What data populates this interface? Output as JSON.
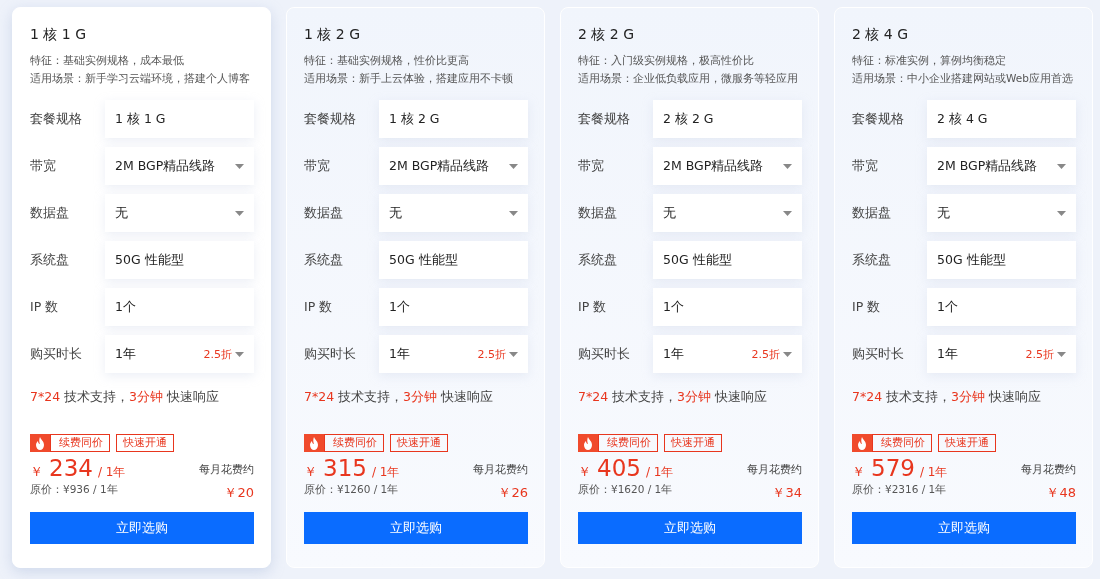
{
  "plans": [
    {
      "title": "1 核 1 G",
      "selected": true,
      "feature": "特征：基础实例规格，成本最低",
      "scene": "适用场景：新手学习云端环境，搭建个人博客",
      "rows": [
        {
          "label": "套餐规格",
          "kind": "text",
          "value": "1 核 1 G"
        },
        {
          "label": "带宽",
          "kind": "select",
          "value": "2M BGP精品线路"
        },
        {
          "label": "数据盘",
          "kind": "select",
          "value": "无"
        },
        {
          "label": "系统盘",
          "kind": "text",
          "value": "50G 性能型"
        },
        {
          "label": "IP 数",
          "kind": "text",
          "value": "1个"
        },
        {
          "label": "购买时长",
          "kind": "select",
          "value": "1年",
          "discount": "2.5折"
        }
      ],
      "support": [
        {
          "text": "7*24",
          "highlight": true
        },
        {
          "text": " 技术支持，",
          "highlight": false
        },
        {
          "text": "3分钟",
          "highlight": true
        },
        {
          "text": " 快速响应",
          "highlight": false
        }
      ],
      "tags": [
        "续费同价",
        "快速开通"
      ],
      "currency": "￥",
      "price": "234",
      "period": "/ 1年",
      "original": "原价：¥936 / 1年",
      "monthly_label": "每月花费约",
      "monthly": "￥20",
      "button": "立即选购"
    },
    {
      "title": "1 核 2 G",
      "selected": false,
      "feature": "特征：基础实例规格，性价比更高",
      "scene": "适用场景：新手上云体验，搭建应用不卡顿",
      "rows": [
        {
          "label": "套餐规格",
          "kind": "text",
          "value": "1 核 2 G"
        },
        {
          "label": "带宽",
          "kind": "select",
          "value": "2M BGP精品线路"
        },
        {
          "label": "数据盘",
          "kind": "select",
          "value": "无"
        },
        {
          "label": "系统盘",
          "kind": "text",
          "value": "50G 性能型"
        },
        {
          "label": "IP 数",
          "kind": "text",
          "value": "1个"
        },
        {
          "label": "购买时长",
          "kind": "select",
          "value": "1年",
          "discount": "2.5折"
        }
      ],
      "support": [
        {
          "text": "7*24",
          "highlight": true
        },
        {
          "text": " 技术支持，",
          "highlight": false
        },
        {
          "text": "3分钟",
          "highlight": true
        },
        {
          "text": " 快速响应",
          "highlight": false
        }
      ],
      "tags": [
        "续费同价",
        "快速开通"
      ],
      "currency": "￥",
      "price": "315",
      "period": "/ 1年",
      "original": "原价：¥1260 / 1年",
      "monthly_label": "每月花费约",
      "monthly": "￥26",
      "button": "立即选购"
    },
    {
      "title": "2 核 2 G",
      "selected": false,
      "feature": "特征：入门级实例规格，极高性价比",
      "scene": "适用场景：企业低负载应用，微服务等轻应用",
      "rows": [
        {
          "label": "套餐规格",
          "kind": "text",
          "value": "2 核 2 G"
        },
        {
          "label": "带宽",
          "kind": "select",
          "value": "2M BGP精品线路"
        },
        {
          "label": "数据盘",
          "kind": "select",
          "value": "无"
        },
        {
          "label": "系统盘",
          "kind": "text",
          "value": "50G 性能型"
        },
        {
          "label": "IP 数",
          "kind": "text",
          "value": "1个"
        },
        {
          "label": "购买时长",
          "kind": "select",
          "value": "1年",
          "discount": "2.5折"
        }
      ],
      "support": [
        {
          "text": "7*24",
          "highlight": true
        },
        {
          "text": " 技术支持，",
          "highlight": false
        },
        {
          "text": "3分钟",
          "highlight": true
        },
        {
          "text": " 快速响应",
          "highlight": false
        }
      ],
      "tags": [
        "续费同价",
        "快速开通"
      ],
      "currency": "￥",
      "price": "405",
      "period": "/ 1年",
      "original": "原价：¥1620 / 1年",
      "monthly_label": "每月花费约",
      "monthly": "￥34",
      "button": "立即选购"
    },
    {
      "title": "2 核 4 G",
      "selected": false,
      "feature": "特征：标准实例，算例均衡稳定",
      "scene": "适用场景：中小企业搭建网站或Web应用首选",
      "rows": [
        {
          "label": "套餐规格",
          "kind": "text",
          "value": "2 核 4 G"
        },
        {
          "label": "带宽",
          "kind": "select",
          "value": "2M BGP精品线路"
        },
        {
          "label": "数据盘",
          "kind": "select",
          "value": "无"
        },
        {
          "label": "系统盘",
          "kind": "text",
          "value": "50G 性能型"
        },
        {
          "label": "IP 数",
          "kind": "text",
          "value": "1个"
        },
        {
          "label": "购买时长",
          "kind": "select",
          "value": "1年",
          "discount": "2.5折"
        }
      ],
      "support": [
        {
          "text": "7*24",
          "highlight": true
        },
        {
          "text": " 技术支持，",
          "highlight": false
        },
        {
          "text": "3分钟",
          "highlight": true
        },
        {
          "text": " 快速响应",
          "highlight": false
        }
      ],
      "tags": [
        "续费同价",
        "快速开通"
      ],
      "currency": "￥",
      "price": "579",
      "period": "/ 1年",
      "original": "原价：¥2316 / 1年",
      "monthly_label": "每月花费约",
      "monthly": "￥48",
      "button": "立即选购"
    }
  ]
}
